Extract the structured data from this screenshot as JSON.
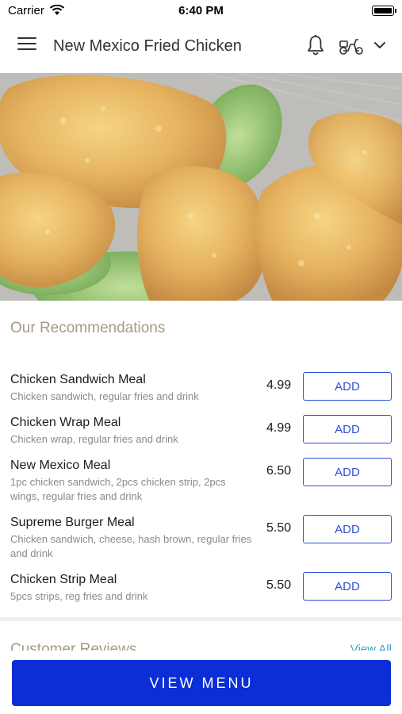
{
  "status_bar": {
    "carrier": "Carrier",
    "time": "6:40 PM"
  },
  "header": {
    "title": "New Mexico Fried Chicken",
    "icons": [
      "menu-icon",
      "bell-icon",
      "scooter-icon",
      "chevron-down-icon"
    ]
  },
  "recommendations": {
    "title": "Our Recommendations",
    "items": [
      {
        "name": "Chicken Sandwich Meal",
        "description": "Chicken sandwich, regular fries and drink",
        "price": "4.99",
        "action": "ADD"
      },
      {
        "name": "Chicken Wrap Meal",
        "description": "Chicken wrap, regular fries and drink",
        "price": "4.99",
        "action": "ADD"
      },
      {
        "name": "New Mexico Meal",
        "description": "1pc chicken sandwich, 2pcs chicken strip, 2pcs wings, regular fries and drink",
        "price": "6.50",
        "action": "ADD"
      },
      {
        "name": "Supreme Burger Meal",
        "description": "Chicken sandwich, cheese, hash brown, regular fries and drink",
        "price": "5.50",
        "action": "ADD"
      },
      {
        "name": "Chicken Strip Meal",
        "description": "5pcs strips, reg fries and drink",
        "price": "5.50",
        "action": "ADD"
      }
    ]
  },
  "reviews": {
    "title": "Customer Reviews",
    "view_all": "View All"
  },
  "footer": {
    "view_menu": "VIEW MENU"
  },
  "colors": {
    "accent": "#0b2ed6",
    "add_button": "#2d4fd8",
    "section_title": "#a89a82",
    "link": "#3aa0c8"
  }
}
